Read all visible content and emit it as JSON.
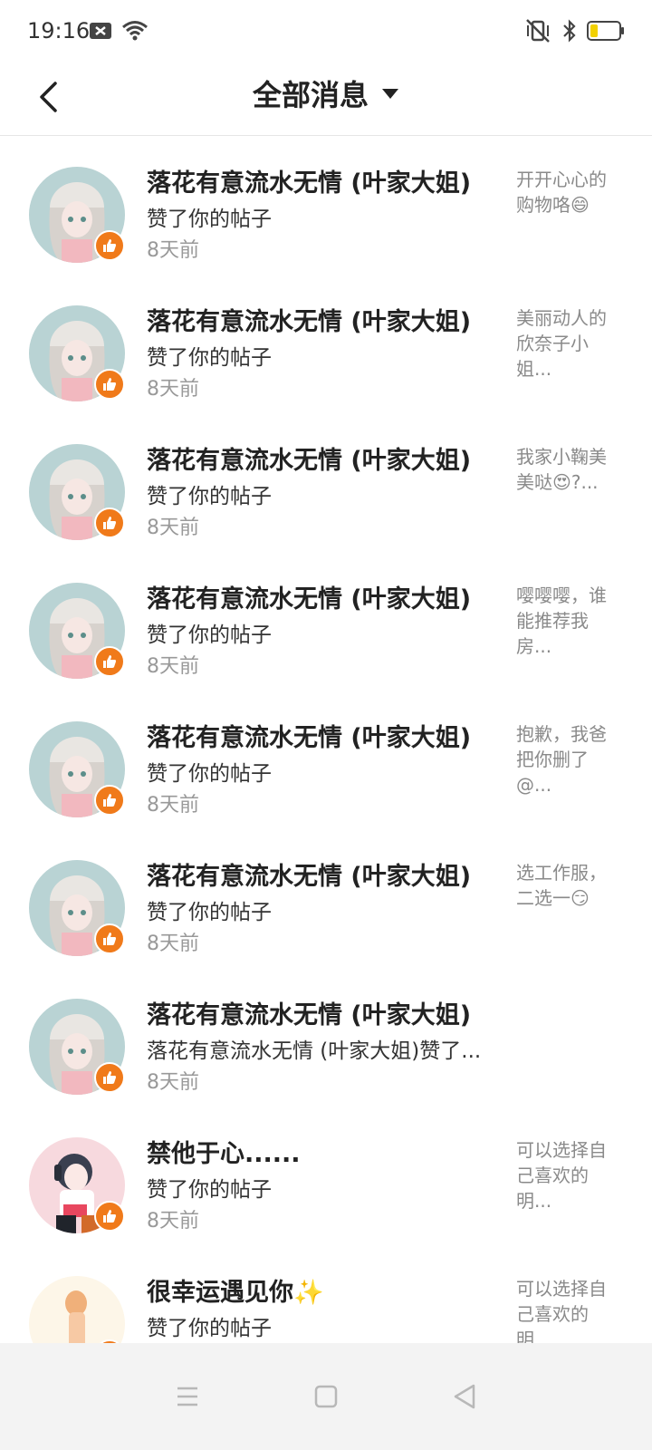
{
  "status_bar": {
    "time": "19:16"
  },
  "header": {
    "title": "全部消息"
  },
  "messages": [
    {
      "name": "落花有意流水无情 (叶家大姐)",
      "action": "赞了你的帖子",
      "time": "8天前",
      "preview": "开开心心的购物咯😄",
      "avatar": "anime-girl-gray"
    },
    {
      "name": "落花有意流水无情 (叶家大姐)",
      "action": "赞了你的帖子",
      "time": "8天前",
      "preview": "美丽动人的欣奈子小姐...",
      "avatar": "anime-girl-gray"
    },
    {
      "name": "落花有意流水无情 (叶家大姐)",
      "action": "赞了你的帖子",
      "time": "8天前",
      "preview": "我家小鞠美美哒😍?...",
      "avatar": "anime-girl-gray"
    },
    {
      "name": "落花有意流水无情 (叶家大姐)",
      "action": "赞了你的帖子",
      "time": "8天前",
      "preview": "嘤嘤嘤，谁能推荐我房...",
      "avatar": "anime-girl-gray"
    },
    {
      "name": "落花有意流水无情 (叶家大姐)",
      "action": "赞了你的帖子",
      "time": "8天前",
      "preview": "抱歉，我爸把你删了@...",
      "avatar": "anime-girl-gray"
    },
    {
      "name": "落花有意流水无情 (叶家大姐)",
      "action": "赞了你的帖子",
      "time": "8天前",
      "preview": "选工作服，二选一😏",
      "avatar": "anime-girl-gray"
    },
    {
      "name": "落花有意流水无情 (叶家大姐)",
      "action": "落花有意流水无情 (叶家大姐)赞了...",
      "time": "8天前",
      "preview": "",
      "avatar": "anime-girl-gray"
    },
    {
      "name": "禁他于心......",
      "action": "赞了你的帖子",
      "time": "8天前",
      "preview": "可以选择自己喜欢的明...",
      "avatar": "anime-girl-headphones"
    },
    {
      "name": "很幸运遇见你✨",
      "action": "赞了你的帖子",
      "time": "",
      "preview": "可以选择自己喜欢的明...",
      "avatar": "anime-girl-light"
    }
  ],
  "colors": {
    "accent": "#f07a1a",
    "divider": "#e6e6e6",
    "secondary_text": "#999999"
  },
  "icons": {
    "back": "chevron-left-icon",
    "title_dropdown": "caret-down-icon",
    "like_badge": "thumbs-up-icon",
    "nav": [
      "menu-icon",
      "home-square-icon",
      "back-triangle-icon"
    ]
  }
}
